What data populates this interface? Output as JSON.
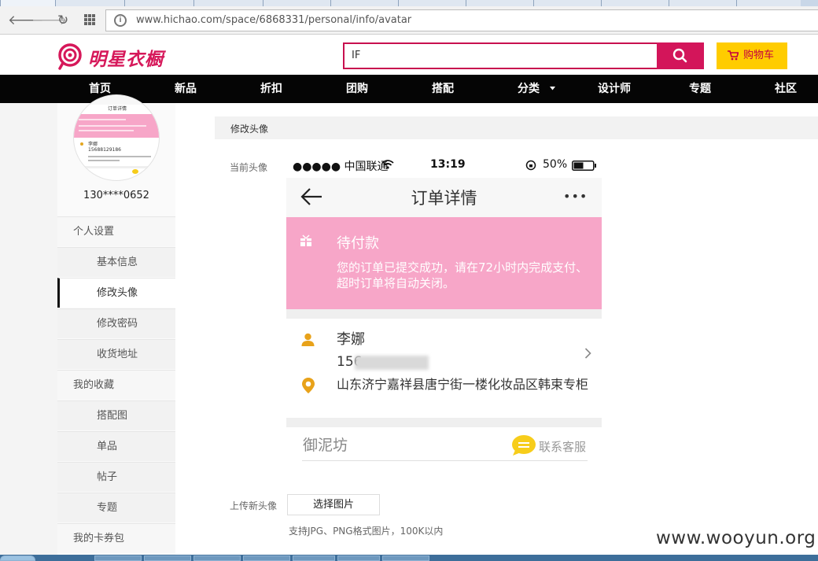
{
  "browser": {
    "url": "www.hichao.com/space/6868331/personal/info/avatar",
    "back_glyph": "🡐",
    "forward_glyph": "🡒",
    "reload_glyph": "↻",
    "site_info_glyph": "i"
  },
  "header": {
    "logo_text": "明星衣橱",
    "search_value": "IF",
    "cart_label": "购物车"
  },
  "nav": {
    "items": [
      "首页",
      "新品",
      "折扣",
      "团购",
      "搭配",
      "分类",
      "设计师",
      "专题",
      "社区"
    ]
  },
  "sidebar": {
    "username": "130****0652",
    "items": [
      {
        "label": "个人设置",
        "type": "group"
      },
      {
        "label": "基本信息",
        "type": "sub"
      },
      {
        "label": "修改头像",
        "type": "sub",
        "active": true
      },
      {
        "label": "修改密码",
        "type": "sub"
      },
      {
        "label": "收货地址",
        "type": "sub"
      },
      {
        "label": "我的收藏",
        "type": "group"
      },
      {
        "label": "搭配图",
        "type": "sub"
      },
      {
        "label": "单品",
        "type": "sub"
      },
      {
        "label": "帖子",
        "type": "sub"
      },
      {
        "label": "专题",
        "type": "sub"
      },
      {
        "label": "我的卡券包",
        "type": "group"
      }
    ],
    "thumb": {
      "title": "订单详情",
      "name": "李娜",
      "phone": "15688129186"
    }
  },
  "content": {
    "title": "修改头像",
    "current_avatar_label": "当前头像",
    "upload_label": "上传新头像",
    "choose_button": "选择图片",
    "hint": "支持JPG、PNG格式图片，100K以内"
  },
  "phone": {
    "carrier": "●●●●● 中国联通",
    "time": "13:19",
    "battery": "50%",
    "app_title": "订单详情",
    "more_glyph": "•••",
    "status_title": "待付款",
    "status_desc": "您的订单已提交成功，请在72小时内完成支付、超时订单将自动关闭。",
    "receiver_name": "李娜",
    "receiver_phone_prefix": "156",
    "address": "山东济宁嘉祥县唐宁街一楼化妆品区韩束专柜",
    "shop_name": "御泥坊",
    "service_label": "联系客服"
  },
  "watermark": "www.wooyun.org",
  "colors": {
    "brand": "#d3155a",
    "cart": "#ffcc00",
    "banner": "#f7a6c8",
    "nav": "#050505"
  }
}
